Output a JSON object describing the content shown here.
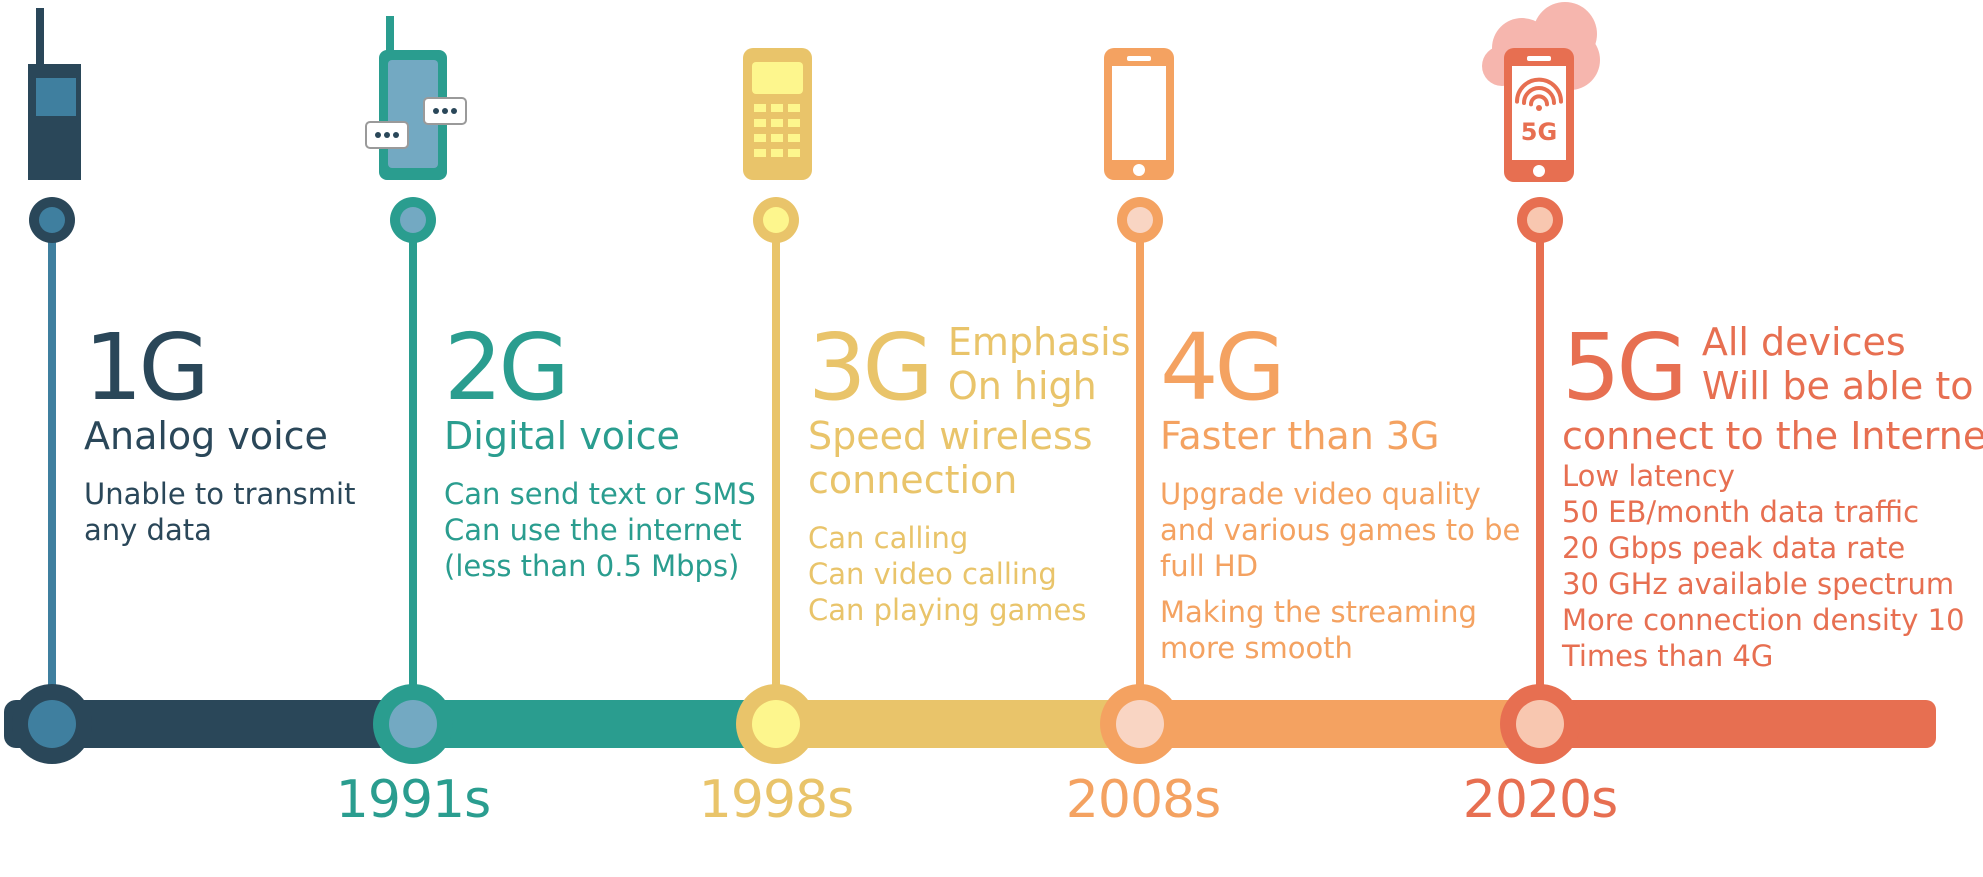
{
  "generations": [
    {
      "code": "1G",
      "emphasis": [],
      "title": [
        "Analog voice"
      ],
      "features": [
        "Unable to transmit",
        "any data"
      ],
      "year": "",
      "color": "#2a4759",
      "node_color": "#3f7f9f",
      "device": "brick-phone-icon"
    },
    {
      "code": "2G",
      "emphasis": [],
      "title": [
        "Digital voice"
      ],
      "features": [
        "Can send text or SMS",
        "Can use the internet",
        "(less than 0.5 Mbps)"
      ],
      "year": "1991s",
      "color": "#2a9d8f",
      "node_color": "#73a9c2",
      "device": "sms-phone-icon"
    },
    {
      "code": "3G",
      "emphasis": [
        "Emphasis",
        "On high"
      ],
      "title": [
        "Speed wireless",
        "connection"
      ],
      "features": [
        "Can calling",
        "Can video calling",
        "Can playing games"
      ],
      "year": "1998s",
      "color": "#e9c46a",
      "node_color": "#fdf68d",
      "device": "keypad-phone-icon"
    },
    {
      "code": "4G",
      "emphasis": [],
      "title": [
        "Faster than 3G"
      ],
      "features": [
        "Upgrade video quality",
        "and various games to be",
        "full HD",
        "Making the streaming",
        "more smooth"
      ],
      "year": "2008s",
      "color": "#f4a261",
      "node_color": "#f9d5c3",
      "device": "smartphone-icon"
    },
    {
      "code": "5G",
      "emphasis": [
        "All devices",
        "Will be able to"
      ],
      "title": [
        "connect to the Internet"
      ],
      "features": [
        "Low latency",
        "50 EB/month data traffic",
        "20 Gbps peak data rate",
        "30 GHz available spectrum",
        "More connection density 10",
        "Times than 4G"
      ],
      "year": "2020s",
      "color": "#e76f51",
      "node_color": "#f8c7b0",
      "device": "5g-cloud-phone-icon",
      "device_label": "5G"
    }
  ]
}
